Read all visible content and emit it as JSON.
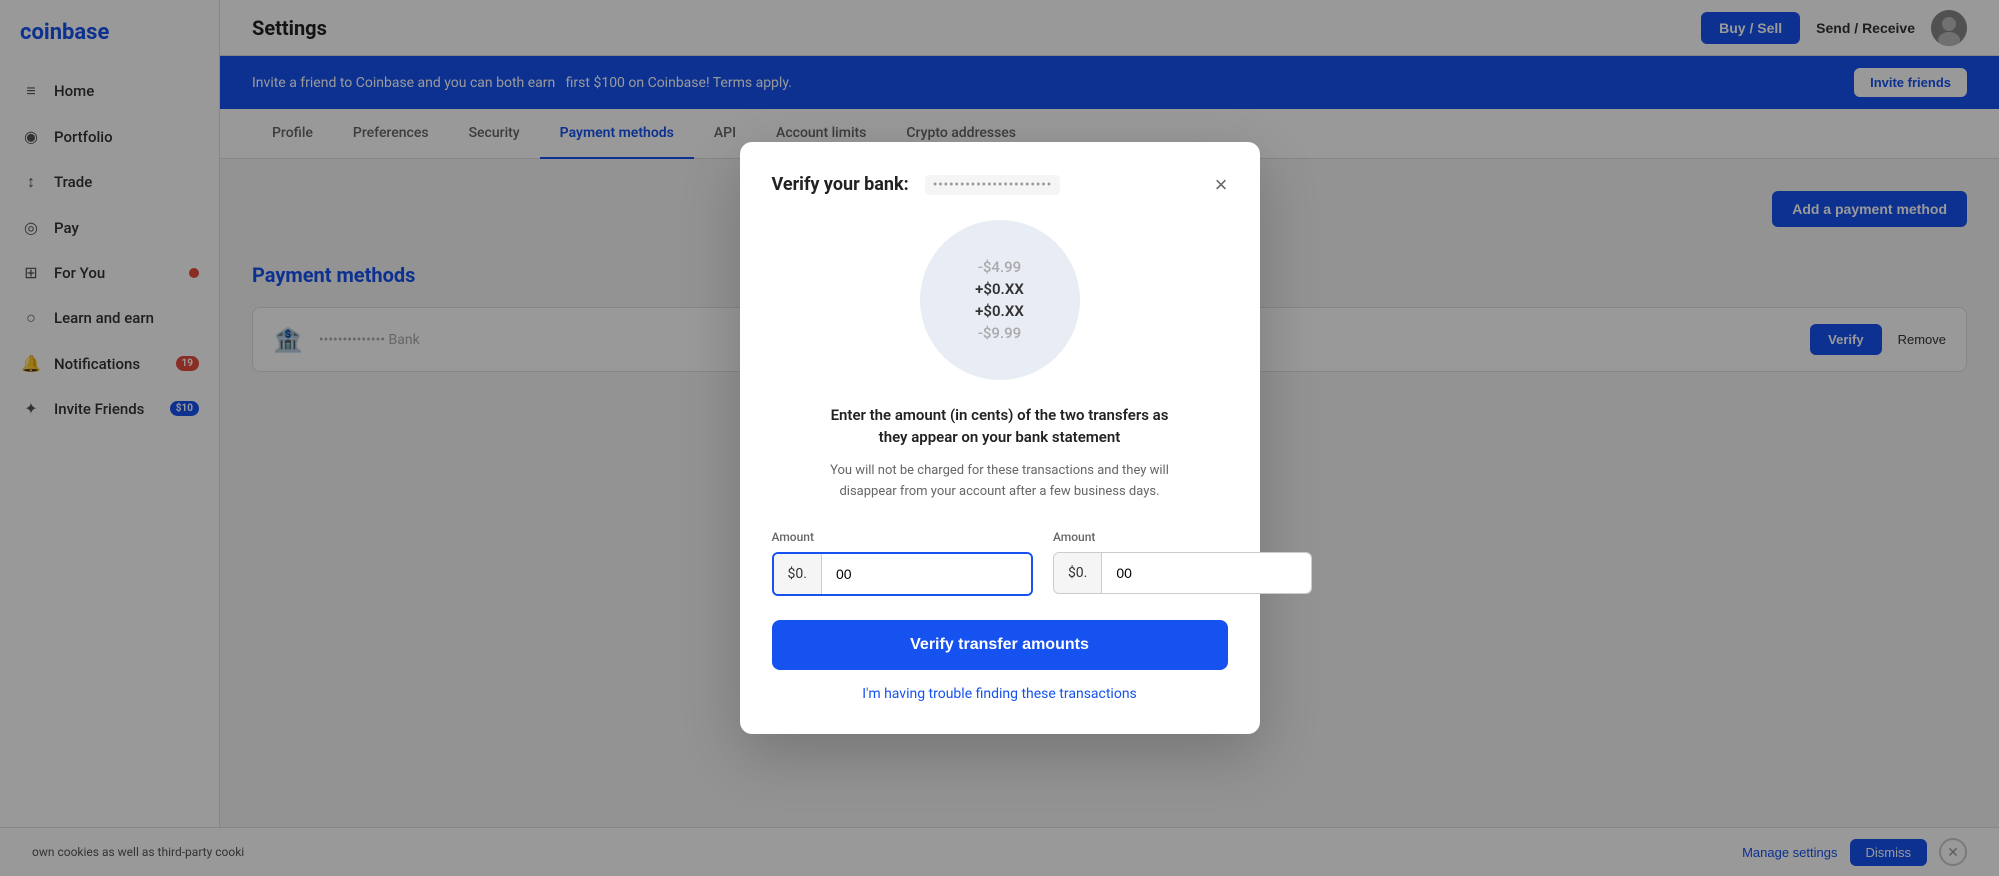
{
  "sidebar": {
    "logo": "coinbase",
    "items": [
      {
        "id": "home",
        "label": "Home",
        "icon": "≡",
        "badge": null
      },
      {
        "id": "portfolio",
        "label": "Portfolio",
        "icon": "◉",
        "badge": null
      },
      {
        "id": "trade",
        "label": "Trade",
        "icon": "↕",
        "badge": null
      },
      {
        "id": "pay",
        "label": "Pay",
        "icon": "◎",
        "badge": null
      },
      {
        "id": "for-you",
        "label": "For You",
        "icon": "⊞",
        "badge": "●",
        "badge_type": "dot_red"
      },
      {
        "id": "learn",
        "label": "Learn and earn",
        "icon": "○",
        "badge": null
      },
      {
        "id": "notifications",
        "label": "Notifications",
        "icon": "🔔",
        "badge": "19",
        "badge_type": "red"
      },
      {
        "id": "invite",
        "label": "Invite Friends",
        "icon": "✦",
        "badge": "$10",
        "badge_type": "blue"
      }
    ]
  },
  "header": {
    "title": "Settings",
    "buy_sell_label": "Buy / Sell",
    "send_receive_label": "Send / Receive"
  },
  "banner": {
    "text": "Invite a friend to Coinbase and you can both earn",
    "text_suffix": "first $100 on Coinbase! Terms apply.",
    "invite_button_label": "Invite friends"
  },
  "settings_tabs": {
    "tabs": [
      {
        "id": "profile",
        "label": "Profile"
      },
      {
        "id": "preferences",
        "label": "Preferences"
      },
      {
        "id": "security",
        "label": "Security"
      },
      {
        "id": "payment-methods",
        "label": "Payment methods",
        "active": true
      },
      {
        "id": "api",
        "label": "API"
      },
      {
        "id": "account-limits",
        "label": "Account limits"
      },
      {
        "id": "crypto-addresses",
        "label": "Crypto addresses"
      }
    ]
  },
  "payment_methods": {
    "title": "Payment methods",
    "add_button_label": "Add a payment method",
    "bank_item": {
      "name": "Bank",
      "verify_label": "Verify",
      "remove_label": "Remove"
    }
  },
  "modal": {
    "title": "Verify your bank:",
    "bank_name_masked": "••••••••••••••••••••••",
    "close_label": "×",
    "circle_amounts": [
      {
        "value": "-$4.99",
        "type": "negative"
      },
      {
        "value": "+$0.XX",
        "type": "positive"
      },
      {
        "value": "+$0.XX",
        "type": "positive"
      },
      {
        "value": "-$9.99",
        "type": "negative"
      }
    ],
    "instructions": "Enter the amount (in cents) of the two transfers as\nthey appear on your bank statement",
    "note": "You will not be charged for these transactions and they will\ndisappear from your account after a few business days.",
    "amount1": {
      "label": "Amount",
      "prefix": "$0.",
      "value": "00",
      "placeholder": "00"
    },
    "amount2": {
      "label": "Amount",
      "prefix": "$0.",
      "value": "00",
      "placeholder": "00"
    },
    "verify_button_label": "Verify transfer amounts",
    "trouble_link_label": "I'm having trouble finding these transactions"
  },
  "cookie_bar": {
    "text": "own cookies as well as third-party cooki",
    "manage_label": "Manage settings",
    "dismiss_label": "Dismiss"
  }
}
